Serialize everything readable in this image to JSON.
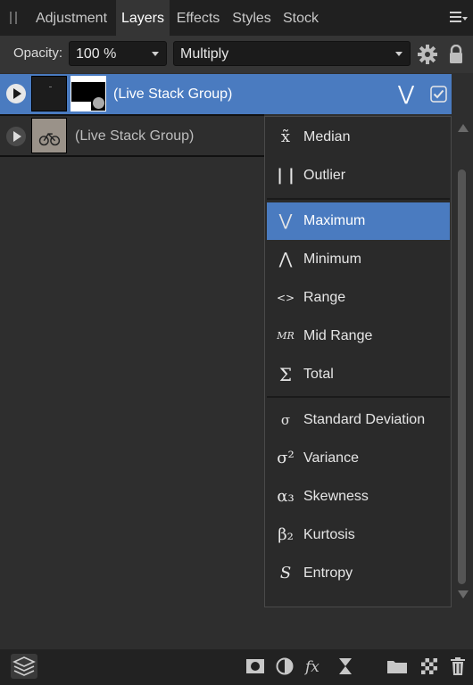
{
  "tabs": [
    {
      "label": "Adjustment"
    },
    {
      "label": "Layers"
    },
    {
      "label": "Effects"
    },
    {
      "label": "Styles"
    },
    {
      "label": "Stock"
    }
  ],
  "options": {
    "opacity_label": "Opacity:",
    "opacity_value": "100 %",
    "blend_mode": "Multiply"
  },
  "layers": [
    {
      "name": "(Live Stack Group)",
      "operator_symbol": "⋁"
    },
    {
      "name": "(Live Stack Group)"
    }
  ],
  "stack_operator_menu": {
    "items": [
      {
        "symbol": "x̃",
        "label": "Median"
      },
      {
        "symbol": "| |",
        "label": "Outlier"
      },
      {
        "symbol": "⋁",
        "label": "Maximum"
      },
      {
        "symbol": "⋀",
        "label": "Minimum"
      },
      {
        "symbol": "<>",
        "label": "Range"
      },
      {
        "symbol": "MR",
        "label": "Mid Range"
      },
      {
        "symbol": "Σ",
        "label": "Total"
      },
      {
        "symbol": "σ",
        "label": "Standard Deviation"
      },
      {
        "symbol": "σ²",
        "label": "Variance"
      },
      {
        "symbol": "α₃",
        "label": "Skewness"
      },
      {
        "symbol": "β₂",
        "label": "Kurtosis"
      },
      {
        "symbol": "S",
        "label": "Entropy"
      }
    ],
    "selected": "Maximum"
  },
  "colors": {
    "selection": "#4a7bc0",
    "panel_bg": "#2e2e2e",
    "tabbar_bg": "#202020"
  }
}
